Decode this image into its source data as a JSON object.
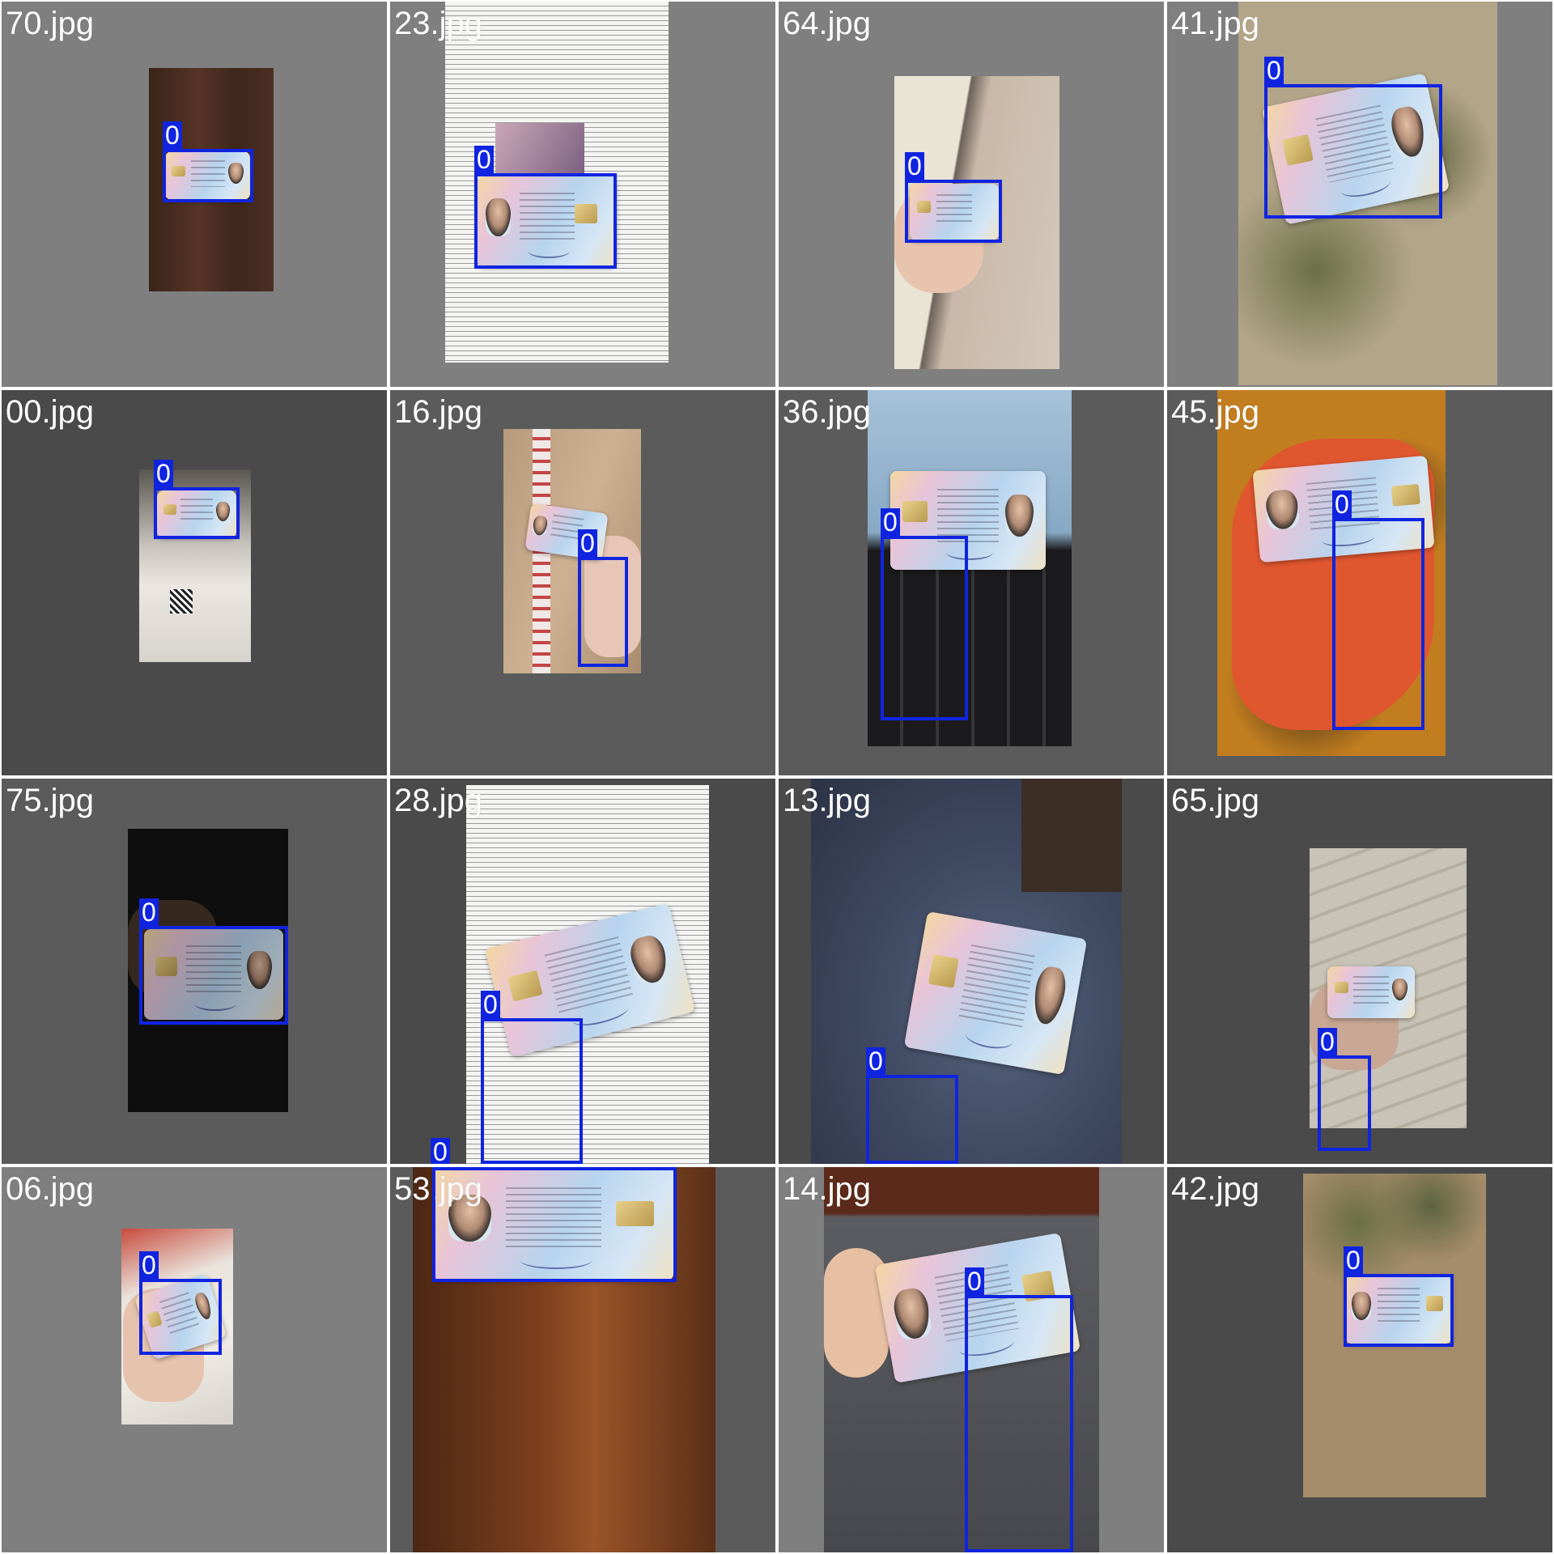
{
  "grid": {
    "cells": [
      {
        "label": "70.jpg",
        "box_tag": "0"
      },
      {
        "label": "23.jpg",
        "box_tag": "0"
      },
      {
        "label": "64.jpg",
        "box_tag": "0"
      },
      {
        "label": "41.jpg",
        "box_tag": "0"
      },
      {
        "label": "00.jpg",
        "box_tag": "0"
      },
      {
        "label": "16.jpg",
        "box_tag": "0"
      },
      {
        "label": "36.jpg",
        "box_tag": "0"
      },
      {
        "label": "45.jpg",
        "box_tag": "0"
      },
      {
        "label": "75.jpg",
        "box_tag": "0"
      },
      {
        "label": "28.jpg",
        "box_tag": "0"
      },
      {
        "label": "13.jpg",
        "box_tag": "0"
      },
      {
        "label": "65.jpg",
        "box_tag": "0"
      },
      {
        "label": "06.jpg",
        "box_tag": "0"
      },
      {
        "label": "53.jpg",
        "box_tag": "0"
      },
      {
        "label": "14.jpg",
        "box_tag": "0"
      },
      {
        "label": "42.jpg",
        "box_tag": "0"
      }
    ],
    "extra_tags": [
      "0",
      "0"
    ]
  },
  "colors": {
    "box": "#1024e0",
    "bg_light": "#7f7f7f",
    "bg_dark": "#4a4a4a",
    "bg_mid": "#5b5b5b"
  }
}
